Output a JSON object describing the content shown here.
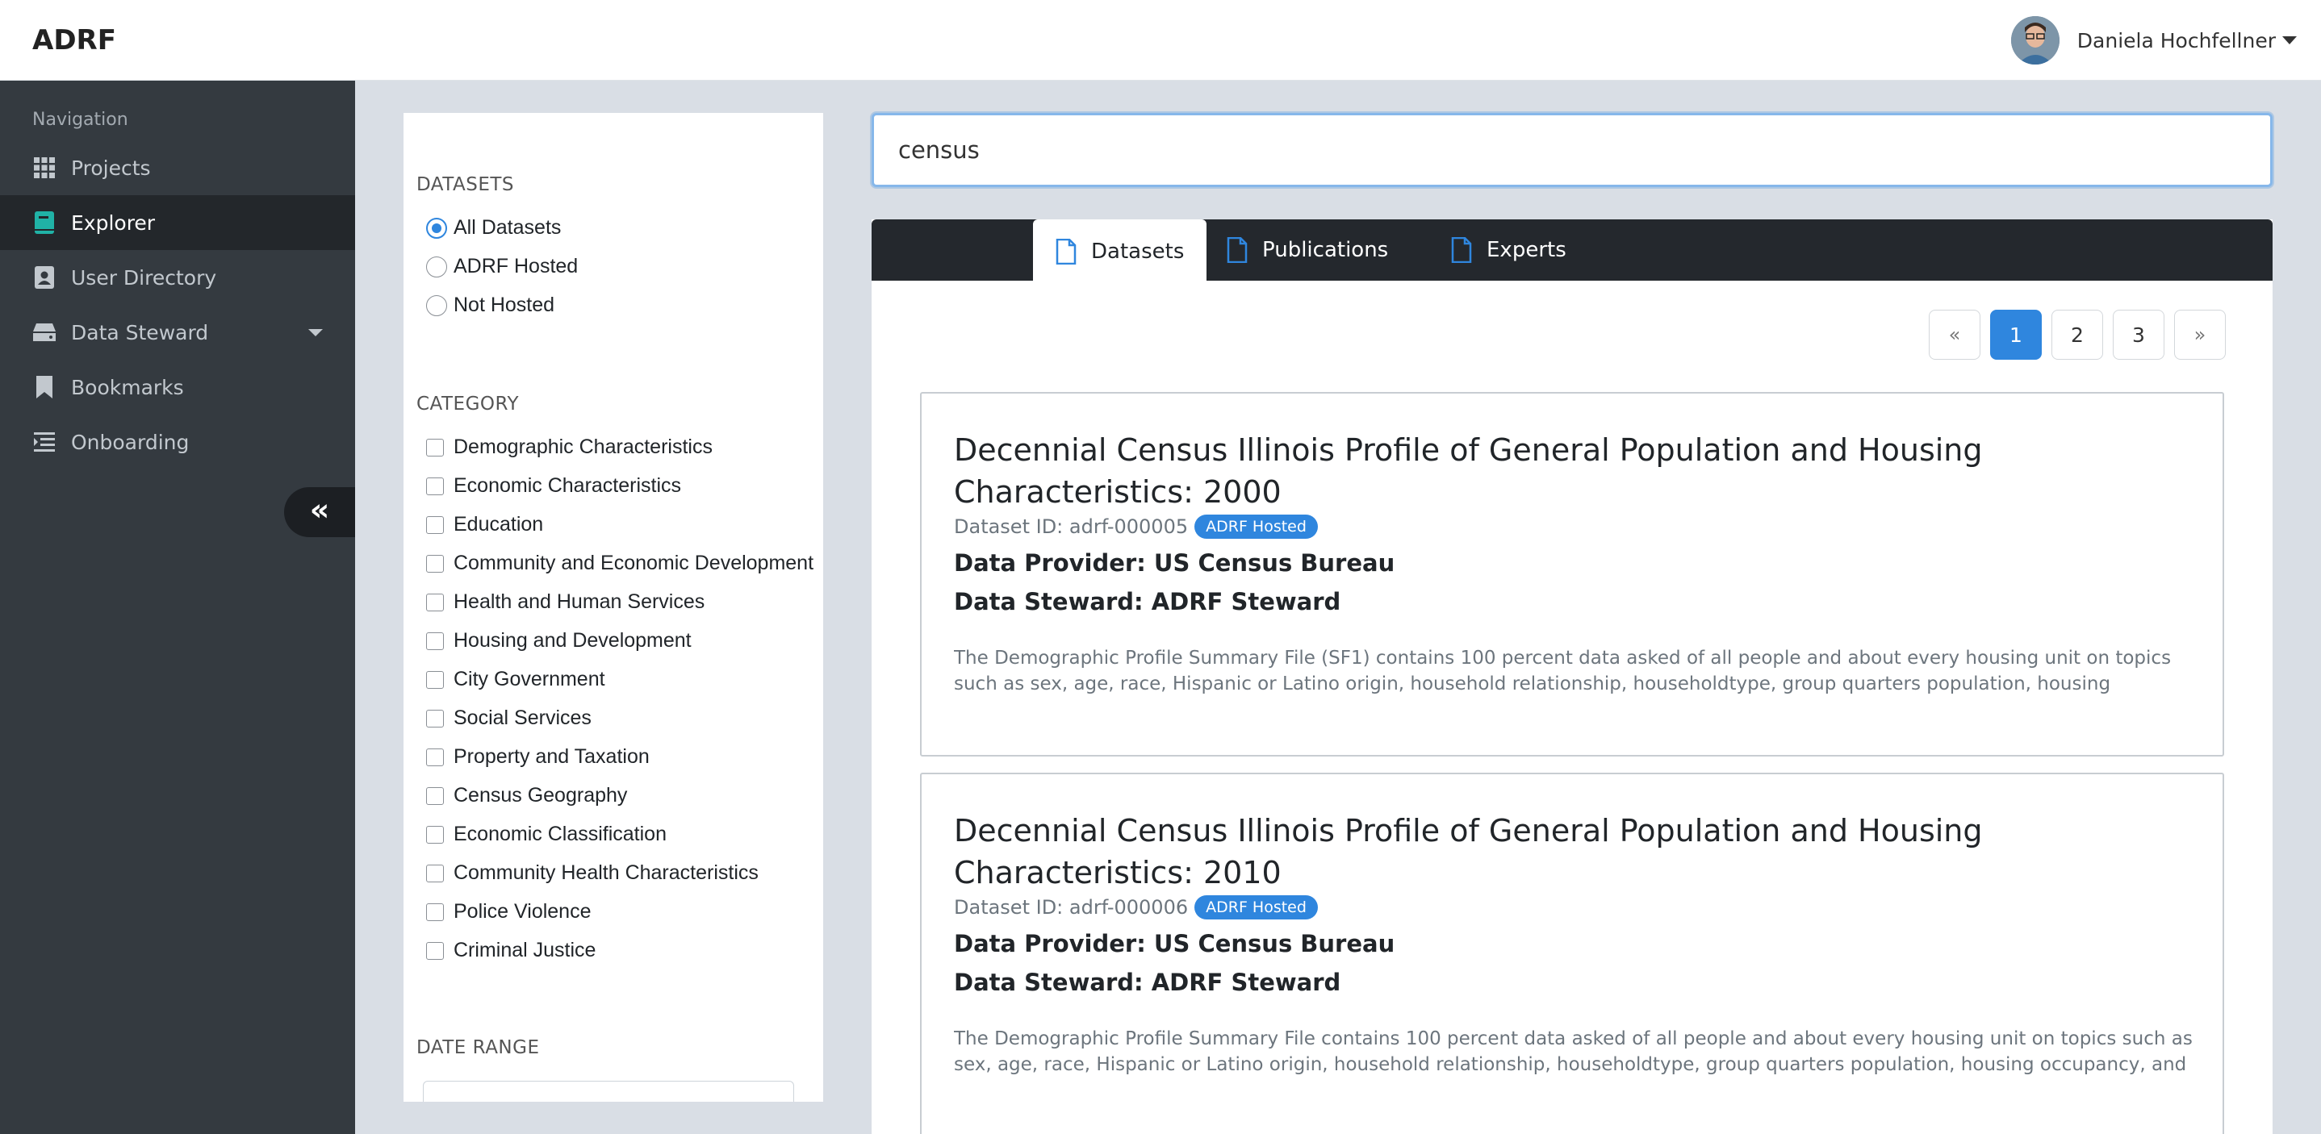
{
  "app": {
    "brand": "ADRF"
  },
  "user": {
    "name": "Daniela Hochfellner"
  },
  "sidebar": {
    "title": "Navigation",
    "items": [
      {
        "label": "Projects",
        "icon": "grid-icon"
      },
      {
        "label": "Explorer",
        "icon": "book-icon",
        "active": true
      },
      {
        "label": "User Directory",
        "icon": "contact-card-icon"
      },
      {
        "label": "Data Steward",
        "icon": "hard-drive-icon",
        "dropdown": true
      },
      {
        "label": "Bookmarks",
        "icon": "bookmark-icon"
      },
      {
        "label": "Onboarding",
        "icon": "list-indent-icon"
      }
    ],
    "collapse_label": "«"
  },
  "filters": {
    "datasets_title": "DATASETS",
    "datasets_options": [
      {
        "label": "All Datasets",
        "checked": true
      },
      {
        "label": "ADRF Hosted",
        "checked": false
      },
      {
        "label": "Not Hosted",
        "checked": false
      }
    ],
    "category_title": "CATEGORY",
    "categories": [
      "Demographic Characteristics",
      "Economic Characteristics",
      "Education",
      "Community and Economic Development",
      "Health and Human Services",
      "Housing and Development",
      "City Government",
      "Social Services",
      "Property and Taxation",
      "Census Geography",
      "Economic Classification",
      "Community Health Characteristics",
      "Police Violence",
      "Criminal Justice"
    ],
    "date_range_title": "DATE RANGE"
  },
  "search": {
    "value": "census"
  },
  "tabs": [
    {
      "label": "Datasets",
      "active": true
    },
    {
      "label": "Publications",
      "active": false
    },
    {
      "label": "Experts",
      "active": false
    }
  ],
  "pager": {
    "prev": "«",
    "pages": [
      "1",
      "2",
      "3"
    ],
    "current": "1",
    "next": "»"
  },
  "results": [
    {
      "title": "Decennial Census Illinois Profile of General Population and Housing Characteristics: 2000",
      "dataset_id": "Dataset ID: adrf-000005",
      "badge": "ADRF Hosted",
      "provider": "Data Provider: US Census Bureau",
      "steward": "Data Steward: ADRF Steward",
      "description": "The Demographic Profile Summary File (SF1) contains 100 percent data asked of all people and about every housing unit on topics such as sex, age, race, Hispanic or Latino origin, household relationship, householdtype, group quarters population, housing occupancy, and"
    },
    {
      "title": "Decennial Census Illinois Profile of General Population and Housing Characteristics: 2010",
      "dataset_id": "Dataset ID: adrf-000006",
      "badge": "ADRF Hosted",
      "provider": "Data Provider: US Census Bureau",
      "steward": "Data Steward: ADRF Steward",
      "description": "The Demographic Profile Summary File contains 100 percent data asked of all people and about every housing unit on topics such as sex, age, race, Hispanic or Latino origin, household relationship, householdtype, group quarters population, housing occupancy, and housing"
    }
  ],
  "colors": {
    "accent": "#2f86de",
    "sidebar_bg": "#343a40",
    "sidebar_active": "#23272b",
    "tabbar_bg": "#24282d",
    "explorer_icon": "#20b2a6"
  }
}
